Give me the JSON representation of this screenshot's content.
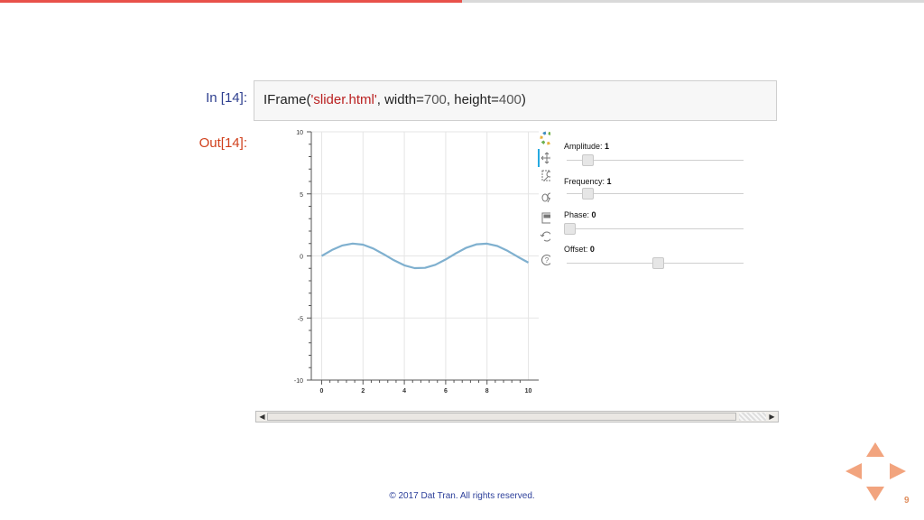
{
  "notebook": {
    "in_prompt": "In [14]:",
    "out_prompt": "Out[14]:",
    "code": {
      "prefix": "IFrame(",
      "string_arg": "'slider.html'",
      "mid1": ", width=",
      "width": "700",
      "mid2": ", height=",
      "height": "400",
      "suffix": ")"
    }
  },
  "toolbar": {
    "icons": [
      "bokeh-logo-icon",
      "pan-icon",
      "box-zoom-icon",
      "wheel-zoom-icon",
      "save-icon",
      "reset-icon",
      "help-icon"
    ]
  },
  "sliders": [
    {
      "name": "Amplitude",
      "value": "1",
      "fraction": 0.1
    },
    {
      "name": "Frequency",
      "value": "1",
      "fraction": 0.1
    },
    {
      "name": "Phase",
      "value": "0",
      "fraction": 0.0
    },
    {
      "name": "Offset",
      "value": "0",
      "fraction": 0.5
    }
  ],
  "chart_data": {
    "type": "line",
    "title": "",
    "xlabel": "",
    "ylabel": "",
    "xlim": [
      -0.5,
      10.5
    ],
    "ylim": [
      -10,
      10
    ],
    "x_ticks": [
      0,
      2,
      4,
      6,
      8,
      10
    ],
    "y_ticks": [
      10,
      5,
      0,
      -5,
      -10
    ],
    "grid": true,
    "series": [
      {
        "color": "#7fb0cf",
        "x": [
          0,
          0.5,
          1,
          1.5,
          2,
          2.5,
          3,
          3.5,
          4,
          4.5,
          5,
          5.5,
          6,
          6.5,
          7,
          7.5,
          8,
          8.5,
          9,
          9.5,
          10
        ],
        "y": [
          0,
          0.48,
          0.84,
          1.0,
          0.91,
          0.6,
          0.14,
          -0.35,
          -0.76,
          -0.98,
          -0.96,
          -0.71,
          -0.28,
          0.22,
          0.66,
          0.94,
          0.99,
          0.8,
          0.41,
          -0.08,
          -0.54
        ]
      }
    ]
  },
  "footer": {
    "copyright": "© 2017 Dat Tran. All rights reserved.",
    "page_number": "9"
  },
  "colors": {
    "accent_red": "#e8514a",
    "nav_orange": "#f2a47e",
    "in_prompt": "#2e3f8f",
    "out_prompt": "#d0401c"
  }
}
